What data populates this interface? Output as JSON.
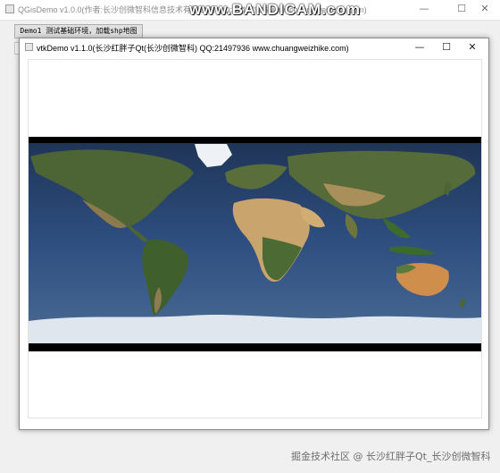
{
  "outer_window": {
    "title": "QGisDemo v1.0.0(作者:长沙创微智科信息技术有限公司 QQ:21497936 www.chuangweizhike.com)",
    "controls": {
      "minimize": "—",
      "maximize": "☐",
      "close": "✕"
    }
  },
  "recording_watermark": "www.BANDICAM.com",
  "demo_button_label": "Demo1 测试基础环境，加载shp地图",
  "inner_window": {
    "title": "vtkDemo v1.1.0(长沙红胖子Qt(长沙创微智科) QQ:21497936 www.chuangweizhike.com)",
    "controls": {
      "minimize": "—",
      "maximize": "☐",
      "close": "✕"
    }
  },
  "map": {
    "description_icon": "world-satellite-map",
    "colors": {
      "ocean": "#2c4a78",
      "land": "#4e6a39",
      "desert": "#c8a26a",
      "ice": "#e8eef4",
      "band": "#000000"
    }
  },
  "footer_watermark": "掘金技术社区 @ 长沙红胖子Qt_长沙创微智科"
}
